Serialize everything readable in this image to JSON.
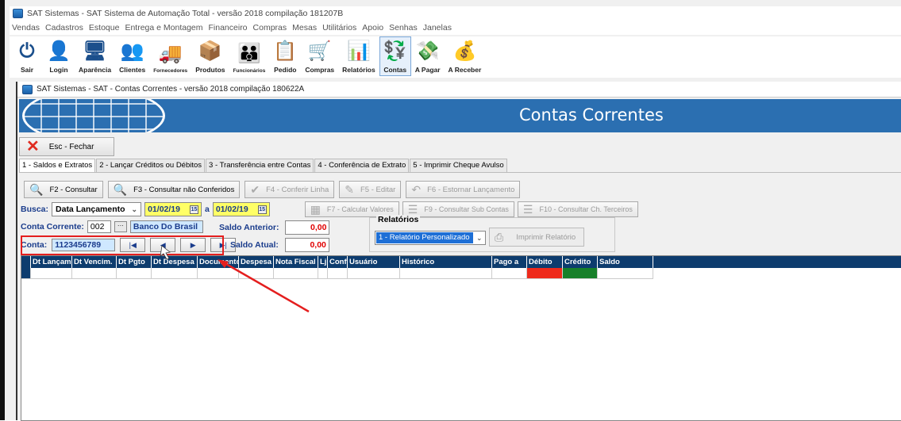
{
  "app": {
    "title": "SAT Sistemas - SAT Sistema de Automação Total - versão 2018 compilação 181207B"
  },
  "menu": [
    "Vendas",
    "Cadastros",
    "Estoque",
    "Entrega e Montagem",
    "Financeiro",
    "Compras",
    "Mesas",
    "Utilitários",
    "Apoio",
    "Senhas",
    "Janelas"
  ],
  "toolbar": [
    {
      "label": "Sair",
      "icon": "power-icon"
    },
    {
      "label": "Login",
      "icon": "user-lock-icon"
    },
    {
      "label": "Aparência",
      "icon": "monitor-icon"
    },
    {
      "label": "Clientes",
      "icon": "clients-icon"
    },
    {
      "label": "Fornecedores",
      "icon": "truck-icon"
    },
    {
      "label": "Produtos",
      "icon": "boxes-icon"
    },
    {
      "label": "Funcionários",
      "icon": "people-icon"
    },
    {
      "label": "Pedido",
      "icon": "clipboard-icon"
    },
    {
      "label": "Compras",
      "icon": "cart-icon"
    },
    {
      "label": "Relatórios",
      "icon": "chart-icon"
    },
    {
      "label": "Contas",
      "icon": "coin-icon"
    },
    {
      "label": "A Pagar",
      "icon": "pay-icon"
    },
    {
      "label": "A Receber",
      "icon": "receive-icon"
    }
  ],
  "child": {
    "title": "SAT Sistemas - SAT - Contas Correntes - versão 2018 compilação 180622A",
    "banner_title": "Contas Correntes",
    "close_label": "Esc - Fechar"
  },
  "tabs": [
    "1 - Saldos e Extratos",
    "2 - Lançar Créditos ou Débitos",
    "3 - Transferência entre Contas",
    "4 - Conferência de Extrato",
    "5 - Imprimir Cheque Avulso"
  ],
  "actions": [
    {
      "label": "F2 - Consultar",
      "enabled": true
    },
    {
      "label": "F3 - Consultar não Conferidos",
      "enabled": true
    },
    {
      "label": "F4 - Conferir Linha",
      "enabled": false
    },
    {
      "label": "F5 - Editar",
      "enabled": false
    },
    {
      "label": "F6 - Estornar Lançamento",
      "enabled": false
    }
  ],
  "actions2": [
    {
      "label": "F7 - Calcular Valores"
    },
    {
      "label": "F9 - Consultar Sub Contas"
    },
    {
      "label": "F10 - Consultar Ch. Terceiros"
    }
  ],
  "busca": {
    "label": "Busca:",
    "type": "Data Lançamento",
    "date_from": "01/02/19",
    "sep": "a",
    "date_to": "01/02/19"
  },
  "conta_corrente": {
    "label": "Conta Corrente:",
    "code": "002",
    "dots": "···",
    "bank": "Banco Do Brasil"
  },
  "conta": {
    "label": "Conta:",
    "number": "1123456789",
    "nav": [
      "|◀",
      "◀",
      "▶",
      "▶|"
    ]
  },
  "saldo_anterior": {
    "label": "Saldo Anterior:",
    "value": "0,00"
  },
  "saldo_atual": {
    "label": "Saldo Atual:",
    "value": "0,00"
  },
  "relatorios": {
    "label": "Relatórios",
    "selected": "1 - Relatório Personalizado",
    "print_label": "Imprimir Relatório"
  },
  "grid": {
    "columns": [
      "Dt Lançam",
      "Dt Vencim.",
      "Dt Pgto",
      "Dt Despesa",
      "Documento",
      "Despesa",
      "Nota Fiscal",
      "Lj",
      "Conf",
      "Usuário",
      "Histórico",
      "Pago a",
      "Débito",
      "Crédito",
      "Saldo"
    ],
    "colors": {
      "header": "#0d3c6e",
      "debito": "#ee2a1b",
      "credito": "#17802a",
      "row_indicator": "#0d3c6e"
    }
  }
}
